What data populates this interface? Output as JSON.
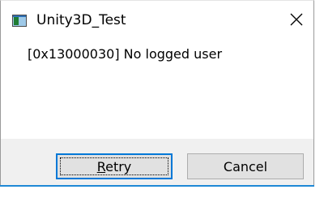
{
  "window": {
    "title": "Unity3D_Test",
    "icon": "application-icon",
    "close_icon": "close-icon"
  },
  "message": {
    "text": "[0x13000030] No logged user"
  },
  "buttons": {
    "retry_mnemonic": "R",
    "retry_rest": "etry",
    "cancel_label": "Cancel"
  },
  "colors": {
    "focus_border": "#0078d7",
    "button_bar_bg": "#f0f0f0",
    "button_bg": "#e1e1e1",
    "bottom_accent": "#1f88d6"
  }
}
